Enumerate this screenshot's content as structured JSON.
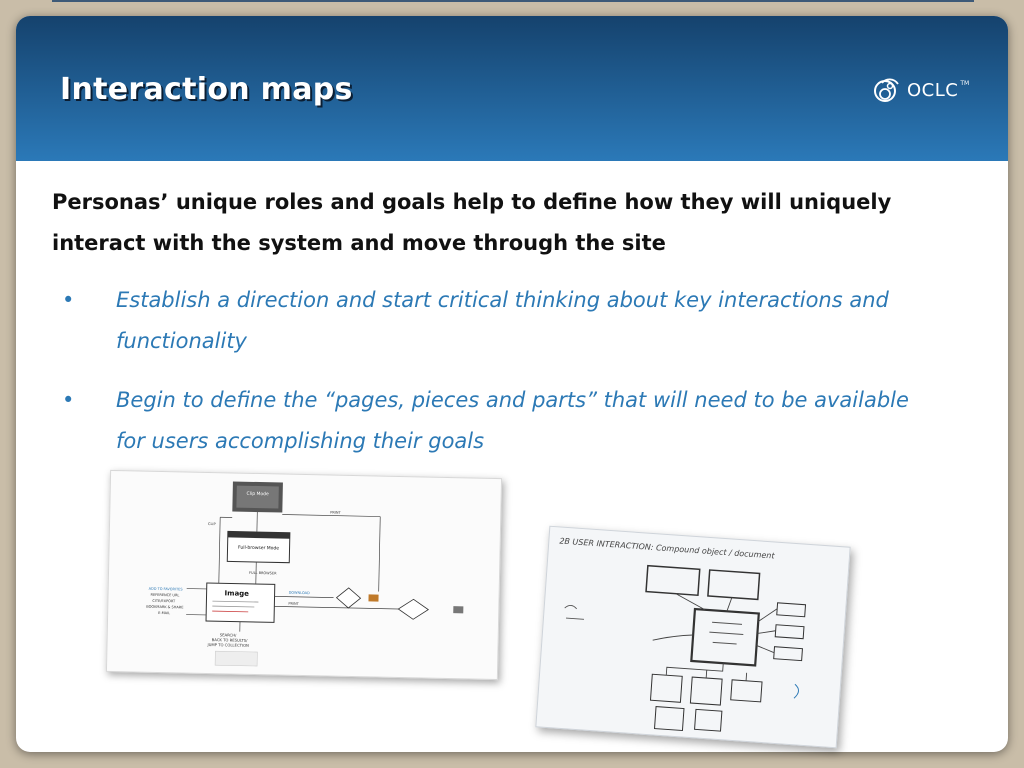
{
  "header": {
    "title": "Interaction maps",
    "logo": {
      "icon": "oclc-logo-icon",
      "text": "OCLC"
    }
  },
  "content": {
    "intro": "Personas’ unique roles and goals help to define how they will uniquely interact with the system and move through the site",
    "bullets": [
      {
        "marker": "•",
        "text": "Establish a direction and start critical thinking about key interactions and functionality"
      },
      {
        "marker": "•",
        "text": "Begin to define the “pages, pieces and parts” that will need to be available for users accomplishing their goals"
      }
    ]
  },
  "colors": {
    "header_top": "#15426d",
    "header_bottom": "#2b79b8",
    "bullet_text": "#2c79b5",
    "intro_text": "#111111",
    "backdrop": "#c9bda8"
  },
  "images": {
    "interaction_map": {
      "clip_mode": "Clip Mode",
      "full_browser_mode": "Full-browser Mode",
      "image_box": "Image",
      "labels": [
        "CLIP",
        "PRINT",
        "FULL BROWSER",
        "DOWNLOAD",
        "PRINT",
        "SEARCH/",
        "BACK TO RESULTS/",
        "JUMP TO COLLECTION"
      ],
      "left_items": [
        "ADD TO FAVORITES",
        "REFERENCE URL",
        "CITE/EXPORT",
        "BOOKMARK & SHARE",
        "E-MAIL"
      ]
    },
    "sketch": {
      "heading": "2B  USER INTERACTION:  Compound object / document"
    }
  }
}
